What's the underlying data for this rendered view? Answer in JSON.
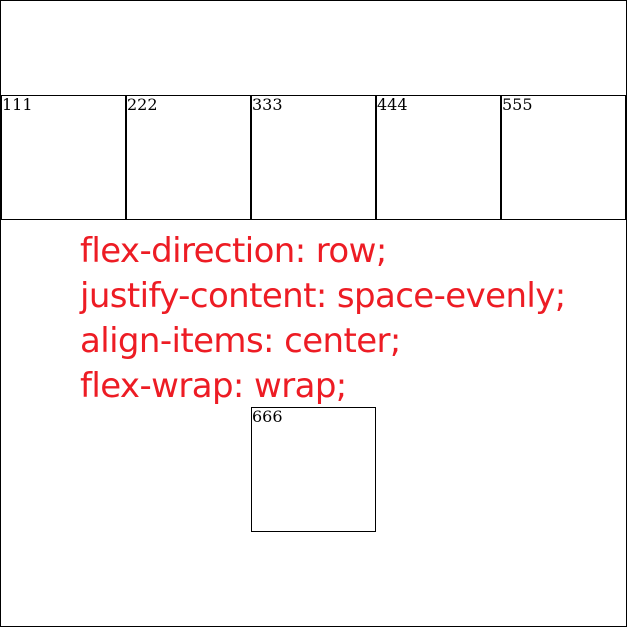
{
  "boxes": [
    {
      "label": "111"
    },
    {
      "label": "222"
    },
    {
      "label": "333"
    },
    {
      "label": "444"
    },
    {
      "label": "555"
    },
    {
      "label": "666"
    }
  ],
  "annotation": {
    "lines": [
      "flex-direction: row;",
      "justify-content: space-evenly;",
      "align-items: center;",
      "flex-wrap: wrap;"
    ],
    "color": "#ed1c24"
  },
  "colors": {
    "border": "#000000",
    "background": "#ffffff"
  }
}
